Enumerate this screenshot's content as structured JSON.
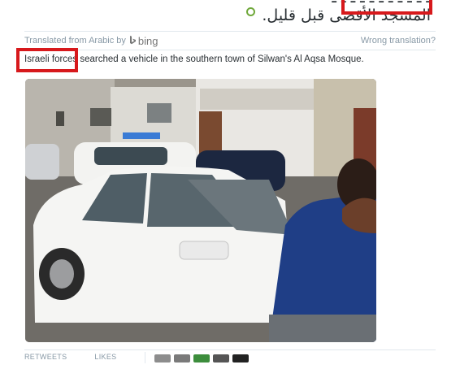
{
  "tweet": {
    "arabic_line1": "المسجد الأقصى قبل قليل.",
    "arabic_line2": "المسجد الأقصى قبل قليل."
  },
  "translation": {
    "label": "Translated from Arabic by",
    "provider": "bing",
    "wrong_link": "Wrong translation?",
    "text": "Israeli forces searched a vehicle in the southern town of Silwan's Al Aqsa Mosque."
  },
  "footer": {
    "retweets_label": "RETWEETS",
    "likes_label": "LIKES"
  },
  "colors": {
    "highlight_box": "#d7191c",
    "geo_dot": "#6fa83a",
    "muted_text": "#8899a6"
  },
  "icons": {
    "geo": "location-dot-icon",
    "bing": "bing-logo-icon"
  }
}
